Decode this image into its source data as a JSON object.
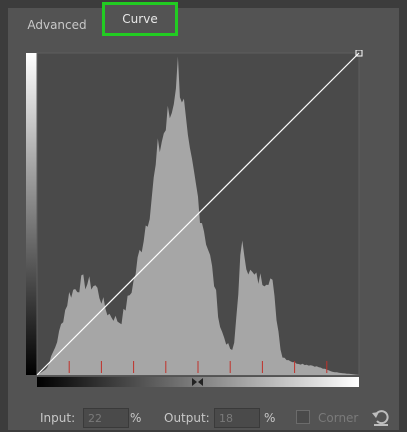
{
  "tabs": [
    {
      "label": "Advanced",
      "active": false
    },
    {
      "label": "Curve",
      "active": true
    }
  ],
  "curve": {
    "input_label": "Input:",
    "input_value": "22",
    "input_unit": "%",
    "output_label": "Output:",
    "output_value": "18",
    "output_unit": "%",
    "corner_label": "Corner",
    "corner_checked": false
  },
  "colors": {
    "highlight": "#22cc22",
    "histogram": "#a6a6a6",
    "curve": "#ffffff",
    "marker": "#c0302a"
  },
  "icons": {
    "reset": "reset-icon",
    "slider": "slider-handle-icon"
  }
}
